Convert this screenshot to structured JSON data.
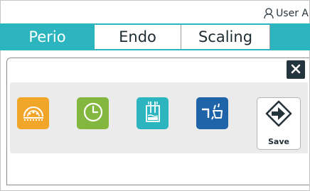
{
  "user": {
    "icon": "user-icon",
    "name": "User A"
  },
  "tabs": [
    {
      "label": "Perio",
      "active": true
    },
    {
      "label": "Endo",
      "active": false
    },
    {
      "label": "Scaling",
      "active": false
    }
  ],
  "panel": {
    "close_icon": "close-icon",
    "tools": [
      {
        "icon": "gauge-dial-icon",
        "color": "#f1a629"
      },
      {
        "icon": "clock-icon",
        "color": "#84b740"
      },
      {
        "icon": "irrigation-icon",
        "color": "#2db5bf"
      },
      {
        "icon": "handpiece-icon",
        "color": "#1f64a8"
      }
    ],
    "save": {
      "icon": "save-arrow-icon",
      "label": "Save"
    }
  },
  "colors": {
    "accent": "#2db5bf",
    "dark": "#24343d"
  }
}
